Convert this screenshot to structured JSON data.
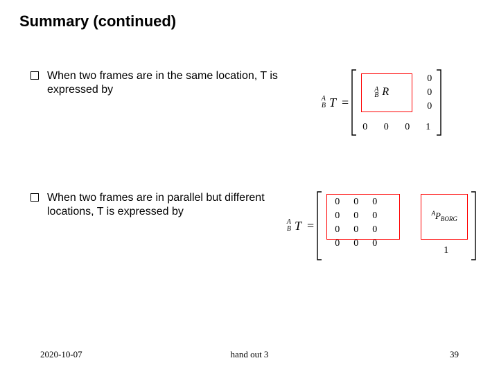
{
  "title": "Summary (continued)",
  "bullets": {
    "b1": "When two frames are in the same location, T is expressed  by",
    "b2": "When two frames are in parallel but different locations, T is expressed by"
  },
  "eq1": {
    "A": "A",
    "B": "B",
    "T": "T",
    "eq": "=",
    "R_A": "A",
    "R_B": "B",
    "R": "R",
    "zcol0": "0",
    "zcol1": "0",
    "zcol2": "0",
    "zrow": "0  0  0",
    "one": "1"
  },
  "eq2": {
    "A": "A",
    "B": "B",
    "T": "T",
    "eq": "=",
    "m": [
      [
        "0",
        "0",
        "0"
      ],
      [
        "0",
        "0",
        "0"
      ],
      [
        "0",
        "0",
        "0"
      ],
      [
        "0",
        "0",
        "0"
      ]
    ],
    "P_A": "A",
    "P": "P",
    "P_sub": "BORG",
    "one": "1"
  },
  "footer": {
    "date": "2020-10-07",
    "hand": "hand out 3",
    "page": "39"
  }
}
